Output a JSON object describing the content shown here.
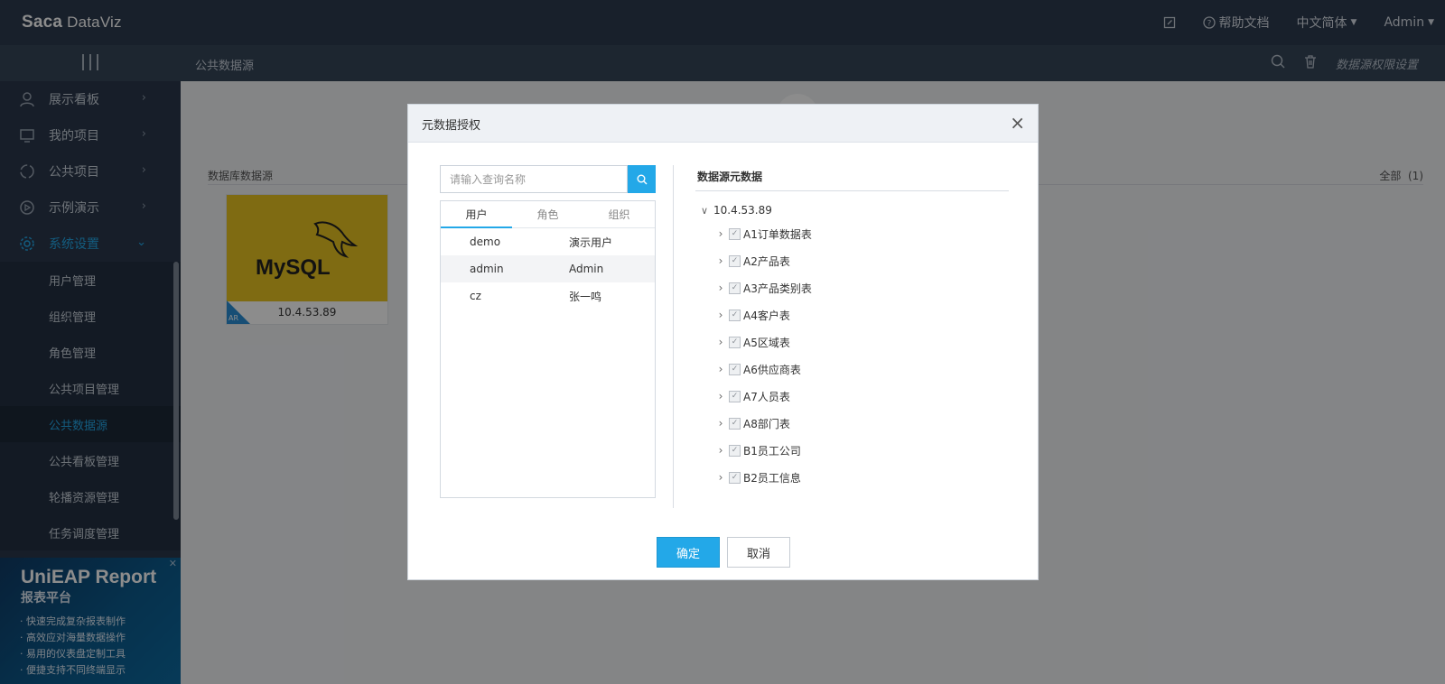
{
  "header": {
    "logo_brand": "Saca",
    "logo_product": " DataViz",
    "edit_icon": "edit-square-icon",
    "help_label": "帮助文档",
    "language_label": "中文简体",
    "user_label": "Admin"
  },
  "subheader": {
    "title": "公共数据源",
    "permission_link": "数据源权限设置"
  },
  "sidebar": {
    "items": [
      {
        "label": "展示看板",
        "icon": "user-icon"
      },
      {
        "label": "我的项目",
        "icon": "monitor-icon"
      },
      {
        "label": "公共项目",
        "icon": "circle-dashed-icon"
      },
      {
        "label": "示例演示",
        "icon": "play-circle-icon"
      },
      {
        "label": "系统设置",
        "icon": "gear-icon"
      }
    ],
    "sub_items": [
      "用户管理",
      "组织管理",
      "角色管理",
      "公共项目管理",
      "公共数据源",
      "公共看板管理",
      "轮播资源管理",
      "任务调度管理"
    ],
    "selected_sub_item": "公共数据源",
    "ad": {
      "title": "UniEAP Report",
      "subtitle": "报表平台",
      "points": [
        "快速完成复杂报表制作",
        "高效应对海量数据操作",
        "易用的仪表盘定制工具",
        "便捷支持不同终端显示"
      ]
    }
  },
  "main": {
    "section_label": "数据库数据源",
    "filter_label": "全部",
    "filter_count": "(1)",
    "datasource_card": {
      "logo_text": "MySQL",
      "name": "10.4.53.89",
      "corner_badge": "AR"
    }
  },
  "modal": {
    "title": "元数据授权",
    "close_label": "×",
    "search": {
      "placeholder": "请输入查询名称",
      "value": ""
    },
    "tabs": [
      "用户",
      "角色",
      "组织"
    ],
    "active_tab": "用户",
    "users": [
      {
        "username": "demo",
        "display_name": "演示用户"
      },
      {
        "username": "admin",
        "display_name": "Admin"
      },
      {
        "username": "cz",
        "display_name": "张一鸣"
      }
    ],
    "tree": {
      "title": "数据源元数据",
      "root": "10.4.53.89",
      "tables": [
        "A1订单数据表",
        "A2产品表",
        "A3产品类别表",
        "A4客户表",
        "A5区域表",
        "A6供应商表",
        "A7人员表",
        "A8部门表",
        "B1员工公司",
        "B2员工信息"
      ]
    },
    "ok_label": "确定",
    "cancel_label": "取消"
  },
  "colors": {
    "accent": "#23a8e8",
    "topbar": "#2c3b4f",
    "sidebar": "#2a384b",
    "mysql_card": "#e8c322"
  }
}
